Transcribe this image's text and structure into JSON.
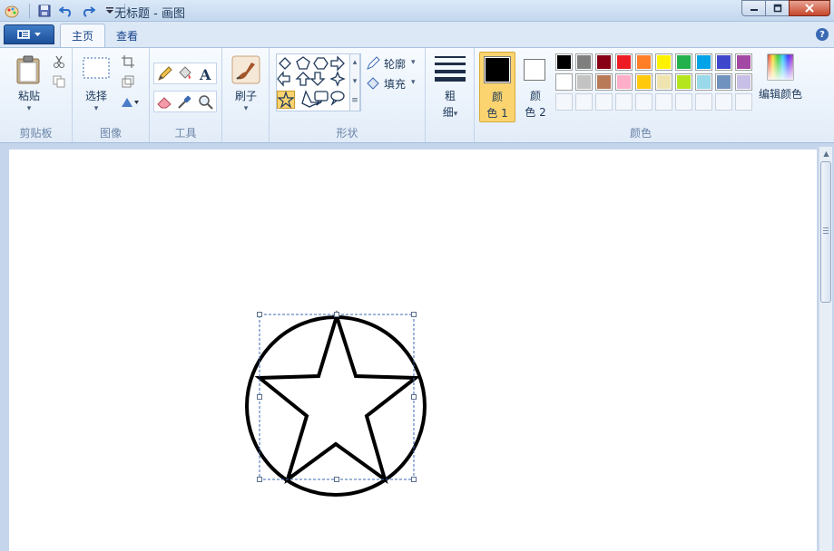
{
  "window": {
    "title": "无标题 - 画图"
  },
  "tabs": [
    {
      "label": "主页",
      "active": true
    },
    {
      "label": "查看",
      "active": false
    }
  ],
  "ribbon": {
    "clipboard": {
      "paste_label": "粘贴",
      "group_label": "剪贴板"
    },
    "image": {
      "select_label": "选择",
      "group_label": "图像"
    },
    "tools": {
      "group_label": "工具"
    },
    "brushes": {
      "label": "刷子"
    },
    "shapes": {
      "outline_label": "轮廓",
      "fill_label": "填充",
      "group_label": "形状"
    },
    "size": {
      "label_line1": "粗",
      "label_line2": "细"
    },
    "colors": {
      "color1_line1": "颜",
      "color1_line2": "色 1",
      "color2_line1": "颜",
      "color2_line2": "色 2",
      "edit_label": "编辑颜色",
      "group_label": "颜色",
      "color1_value": "#000000",
      "color2_value": "#ffffff",
      "palette_row1": [
        "#000000",
        "#7f7f7f",
        "#880015",
        "#ed1c24",
        "#ff7f27",
        "#fff200",
        "#22b14c",
        "#00a2e8",
        "#3f48cc",
        "#a349a4"
      ],
      "palette_row2": [
        "#ffffff",
        "#c3c3c3",
        "#b97a57",
        "#ffaec9",
        "#ffc90e",
        "#efe4b0",
        "#b5e61d",
        "#99d9ea",
        "#7092be",
        "#c8bfe7"
      ],
      "palette_row3": [
        "",
        "",
        "",
        "",
        "",
        "",
        "",
        "",
        "",
        ""
      ]
    }
  },
  "accent": {
    "selected_button": "#fbd46f",
    "ribbon_text": "#1e395b"
  }
}
